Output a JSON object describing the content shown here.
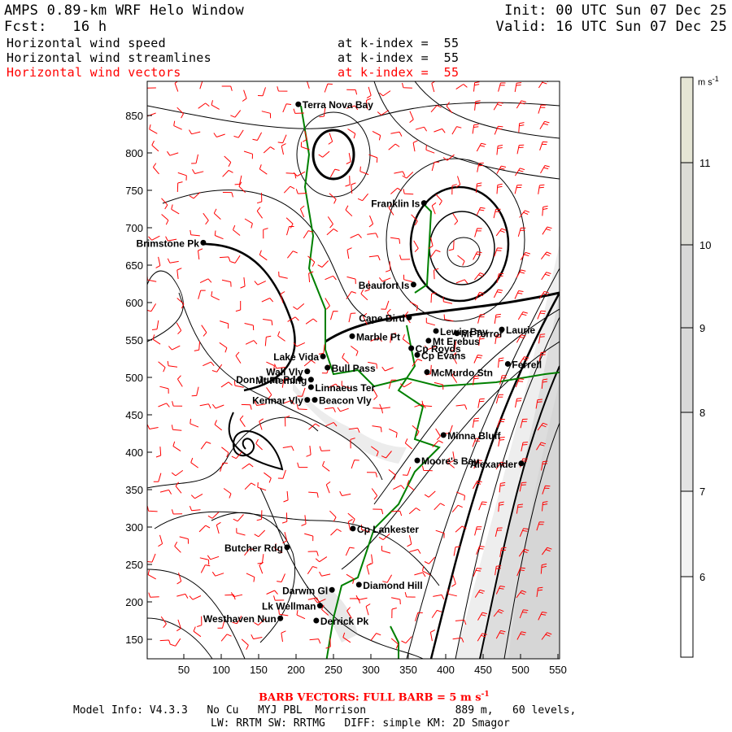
{
  "header": {
    "title": "AMPS 0.89-km WRF Helo Window",
    "forecast": "Fcst:   16 h",
    "init": "Init: 00 UTC Sun 07 Dec 25",
    "valid": "Valid: 16 UTC Sun 07 Dec 25",
    "fields": [
      {
        "name": "Horizontal wind speed",
        "level": "at k-index =  55"
      },
      {
        "name": "Horizontal wind streamlines",
        "level": "at k-index =  55"
      },
      {
        "name": "Horizontal wind vectors",
        "level": "at k-index =  55"
      }
    ]
  },
  "colors": {
    "vectors": "#ff0000",
    "coast": "#008000",
    "streamlines": "#000000"
  },
  "colorbar": {
    "units": "m s-1",
    "labels": [
      "11",
      "10",
      "9",
      "8",
      "7",
      "6"
    ],
    "bins": [
      {
        "from": 11,
        "color": "#e5e5d5"
      },
      {
        "from": 10,
        "to": 11,
        "color": "#dcdcd6"
      },
      {
        "from": 9,
        "to": 10,
        "color": "#d8d8d8"
      },
      {
        "from": 8,
        "to": 9,
        "color": "#d9d9d9"
      },
      {
        "from": 7,
        "to": 8,
        "color": "#e3e3e3"
      },
      {
        "from": 6,
        "to": 7,
        "color": "#f3f3f3"
      },
      {
        "to": 6,
        "color": "#ffffff"
      }
    ]
  },
  "chart_data": {
    "type": "map",
    "x_ticks": [
      "50",
      "100",
      "150",
      "200",
      "250",
      "300",
      "350",
      "400",
      "450",
      "500",
      "550"
    ],
    "y_ticks": [
      "850",
      "800",
      "750",
      "700",
      "650",
      "600",
      "550",
      "500",
      "450",
      "400",
      "350",
      "300",
      "250",
      "200",
      "150"
    ],
    "xlim": [
      1,
      552
    ],
    "ylim": [
      124,
      896
    ],
    "locations": [
      {
        "name": "Terra Nova Bay",
        "x": 203,
        "y": 865
      },
      {
        "name": "Franklin Is",
        "x": 371,
        "y": 733
      },
      {
        "name": "Brimstone Pk",
        "x": 76,
        "y": 680
      },
      {
        "name": "Beaufort Is",
        "x": 357,
        "y": 624
      },
      {
        "name": "Cape Bird",
        "x": 351,
        "y": 580
      },
      {
        "name": "Marble Pt",
        "x": 275,
        "y": 555
      },
      {
        "name": "Lewis Bay",
        "x": 387,
        "y": 562
      },
      {
        "name": "Mt Terror",
        "x": 415,
        "y": 559
      },
      {
        "name": "Laurie",
        "x": 475,
        "y": 564
      },
      {
        "name": "Cp Royds",
        "x": 354,
        "y": 539
      },
      {
        "name": "Mt Erebus",
        "x": 377,
        "y": 549
      },
      {
        "name": "Cp Evans",
        "x": 362,
        "y": 530
      },
      {
        "name": "McMurdo Stn",
        "x": 375,
        "y": 507
      },
      {
        "name": "Ferrell",
        "x": 483,
        "y": 518
      },
      {
        "name": "Lake Vida",
        "x": 236,
        "y": 528
      },
      {
        "name": "Wall Vly",
        "x": 215,
        "y": 508
      },
      {
        "name": "Bull Pass",
        "x": 242,
        "y": 513
      },
      {
        "name": "Don Juan Pd",
        "x": 205,
        "y": 498
      },
      {
        "name": "Mt Fleming",
        "x": 220,
        "y": 497
      },
      {
        "name": "Linnaeus Ter",
        "x": 220,
        "y": 487
      },
      {
        "name": "Kennar Vly",
        "x": 215,
        "y": 470
      },
      {
        "name": "Beacon Vly",
        "x": 225,
        "y": 470
      },
      {
        "name": "Minna Bluff",
        "x": 397,
        "y": 423
      },
      {
        "name": "Moore's Bay",
        "x": 362,
        "y": 389
      },
      {
        "name": "Alexander",
        "x": 501,
        "y": 385
      },
      {
        "name": "Cp Lankester",
        "x": 276,
        "y": 298
      },
      {
        "name": "Butcher Rdg",
        "x": 188,
        "y": 273
      },
      {
        "name": "Diamond Hill",
        "x": 284,
        "y": 223
      },
      {
        "name": "Darwin Gl",
        "x": 248,
        "y": 216
      },
      {
        "name": "Lk Wellman",
        "x": 232,
        "y": 195
      },
      {
        "name": "Westhaven Nun",
        "x": 179,
        "y": 178
      },
      {
        "name": "Derrick Pk",
        "x": 227,
        "y": 175
      }
    ]
  },
  "footer": {
    "barb_note": "BARB VECTORS:  FULL BARB = 5 m s",
    "barb_note_sup": "-1",
    "model_info": "Model Info: V4.3.3   No Cu   MYJ PBL  Morrison              889 m,   60 levels,",
    "model_info2": "LW: RRTM SW: RRTMG   DIFF: simple KM: 2D Smagor"
  }
}
